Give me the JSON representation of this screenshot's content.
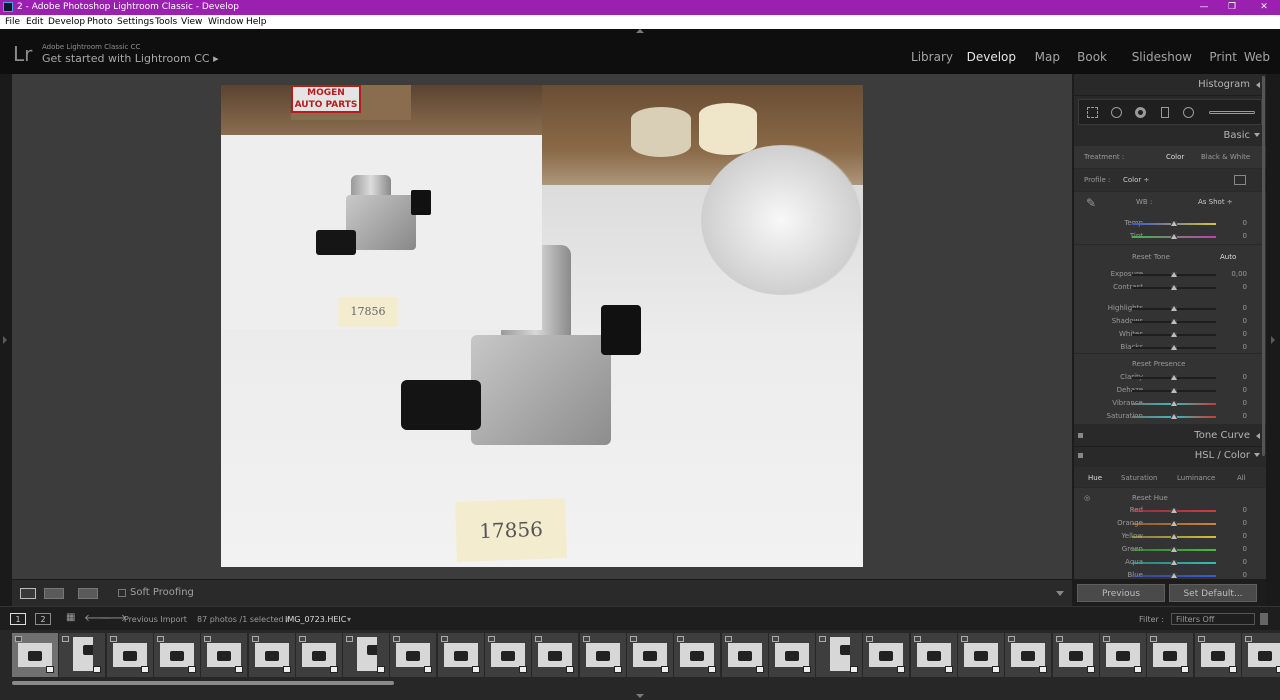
{
  "window": {
    "title": "2 - Adobe Photoshop Lightroom Classic - Develop"
  },
  "menu": [
    "File",
    "Edit",
    "Develop",
    "Photo",
    "Settings",
    "Tools",
    "View",
    "Window",
    "Help"
  ],
  "identity": {
    "logo": "Lr",
    "small": "Adobe Lightroom Classic CC",
    "big": "Get started with Lightroom CC  ▸"
  },
  "modules": [
    "Library",
    "Develop",
    "Map",
    "Book",
    "Slideshow",
    "Print",
    "Web"
  ],
  "active_module": "Develop",
  "photo": {
    "label_main": "17856",
    "label_inset": "17856",
    "sticker": "MOGEN AUTO PARTS"
  },
  "toolbar": {
    "soft_proofing": "Soft Proofing"
  },
  "panels": {
    "histogram": "Histogram",
    "basic": "Basic",
    "treatment_label": "Treatment :",
    "treatment_color": "Color",
    "treatment_bw": "Black & White",
    "profile_label": "Profile :",
    "profile_value": "Color ÷",
    "wb_label": "WB :",
    "wb_value": "As Shot ÷",
    "reset_tone": "Reset Tone",
    "auto": "Auto",
    "reset_presence": "Reset Presence",
    "tone_curve": "Tone Curve",
    "hsl_color": "HSL / Color",
    "hsl_tabs": [
      "Hue",
      "Saturation",
      "Luminance",
      "All"
    ],
    "reset_hue": "Reset Hue",
    "wb_sliders": [
      {
        "label": "Temp",
        "value": "0",
        "pos": 0.5
      },
      {
        "label": "Tint",
        "value": "0",
        "pos": 0.5
      }
    ],
    "tone_sliders": [
      {
        "label": "Exposure",
        "value": "0,00",
        "pos": 0.5
      },
      {
        "label": "Contrast",
        "value": "0",
        "pos": 0.5
      },
      {
        "label": "Highlights",
        "value": "0",
        "pos": 0.5
      },
      {
        "label": "Shadows",
        "value": "0",
        "pos": 0.5
      },
      {
        "label": "Whites",
        "value": "0",
        "pos": 0.5
      },
      {
        "label": "Blacks",
        "value": "0",
        "pos": 0.5
      }
    ],
    "presence_sliders": [
      {
        "label": "Clarity",
        "value": "0",
        "pos": 0.5
      },
      {
        "label": "Dehaze",
        "value": "0",
        "pos": 0.5
      },
      {
        "label": "Vibrance",
        "value": "0",
        "pos": 0.5
      },
      {
        "label": "Saturation",
        "value": "0",
        "pos": 0.5
      }
    ],
    "hue_sliders": [
      {
        "label": "Red",
        "value": "0",
        "pos": 0.5,
        "color": "#d23a3a"
      },
      {
        "label": "Orange",
        "value": "0",
        "pos": 0.5,
        "color": "#d2823a"
      },
      {
        "label": "Yellow",
        "value": "0",
        "pos": 0.5,
        "color": "#c9c23a"
      },
      {
        "label": "Green",
        "value": "0",
        "pos": 0.5,
        "color": "#4ab84a"
      },
      {
        "label": "Aqua",
        "value": "0",
        "pos": 0.5,
        "color": "#3ab8b8"
      },
      {
        "label": "Blue",
        "value": "0",
        "pos": 0.5,
        "color": "#3a5ad2"
      }
    ]
  },
  "nav_buttons": {
    "previous": "Previous",
    "set_default": "Set Default..."
  },
  "filmstrip_bar": {
    "screen1": "1",
    "screen2": "2",
    "source": "Previous Import",
    "count_text": "87 photos /1 selected /",
    "filename": "IMG_0723.HEIC",
    "filter_label": "Filter :",
    "filter_value": "Filters Off"
  },
  "colors": {
    "title_bar": "#9b1fb0",
    "panel": "#292929",
    "canvas": "#3c3c3c"
  }
}
